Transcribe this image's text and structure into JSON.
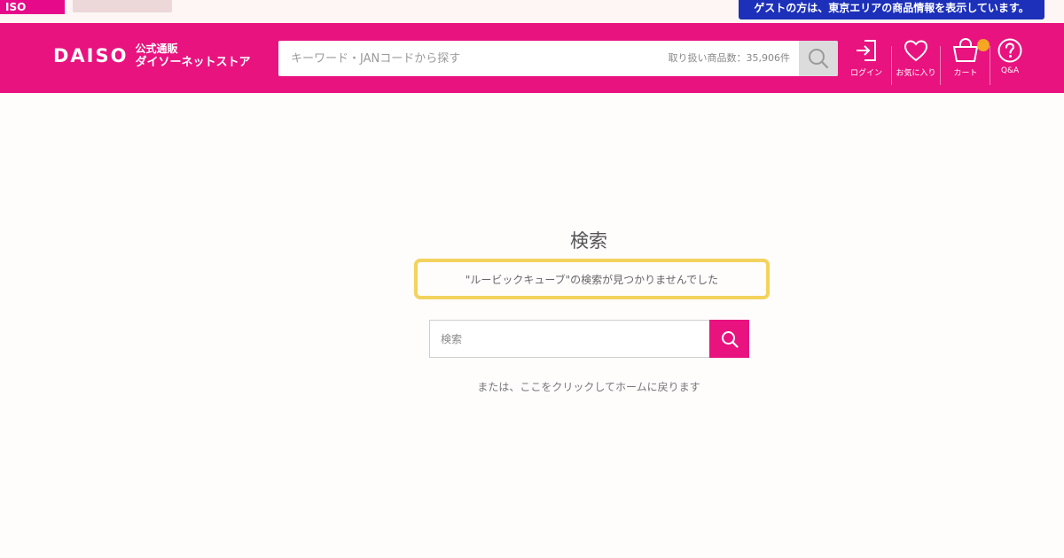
{
  "topstrip": {
    "left_tab_label": "ISO",
    "guest_banner": "ゲストの方は、東京エリアの商品情報を表示しています。"
  },
  "header": {
    "logo_wordmark": "DAISO",
    "logo_sub_line1": "公式通販",
    "logo_sub_line2": "ダイソーネットストア",
    "search_placeholder": "キーワード・JANコードから探す",
    "product_count": "取り扱い商品数：35,906件",
    "icons": {
      "login": "ログイン",
      "favorites": "お気に入り",
      "cart": "カート",
      "qa": "Q&A"
    }
  },
  "main": {
    "title": "検索",
    "not_found_message": "\"ルービックキューブ\"の検索が見つかりませんでした",
    "search_placeholder": "検索",
    "home_link": "または、ここをクリックしてホームに戻ります"
  },
  "colors": {
    "brand_pink": "#e8137f",
    "highlight_yellow": "#f3d35d",
    "guest_banner_blue": "#1c30b9"
  }
}
